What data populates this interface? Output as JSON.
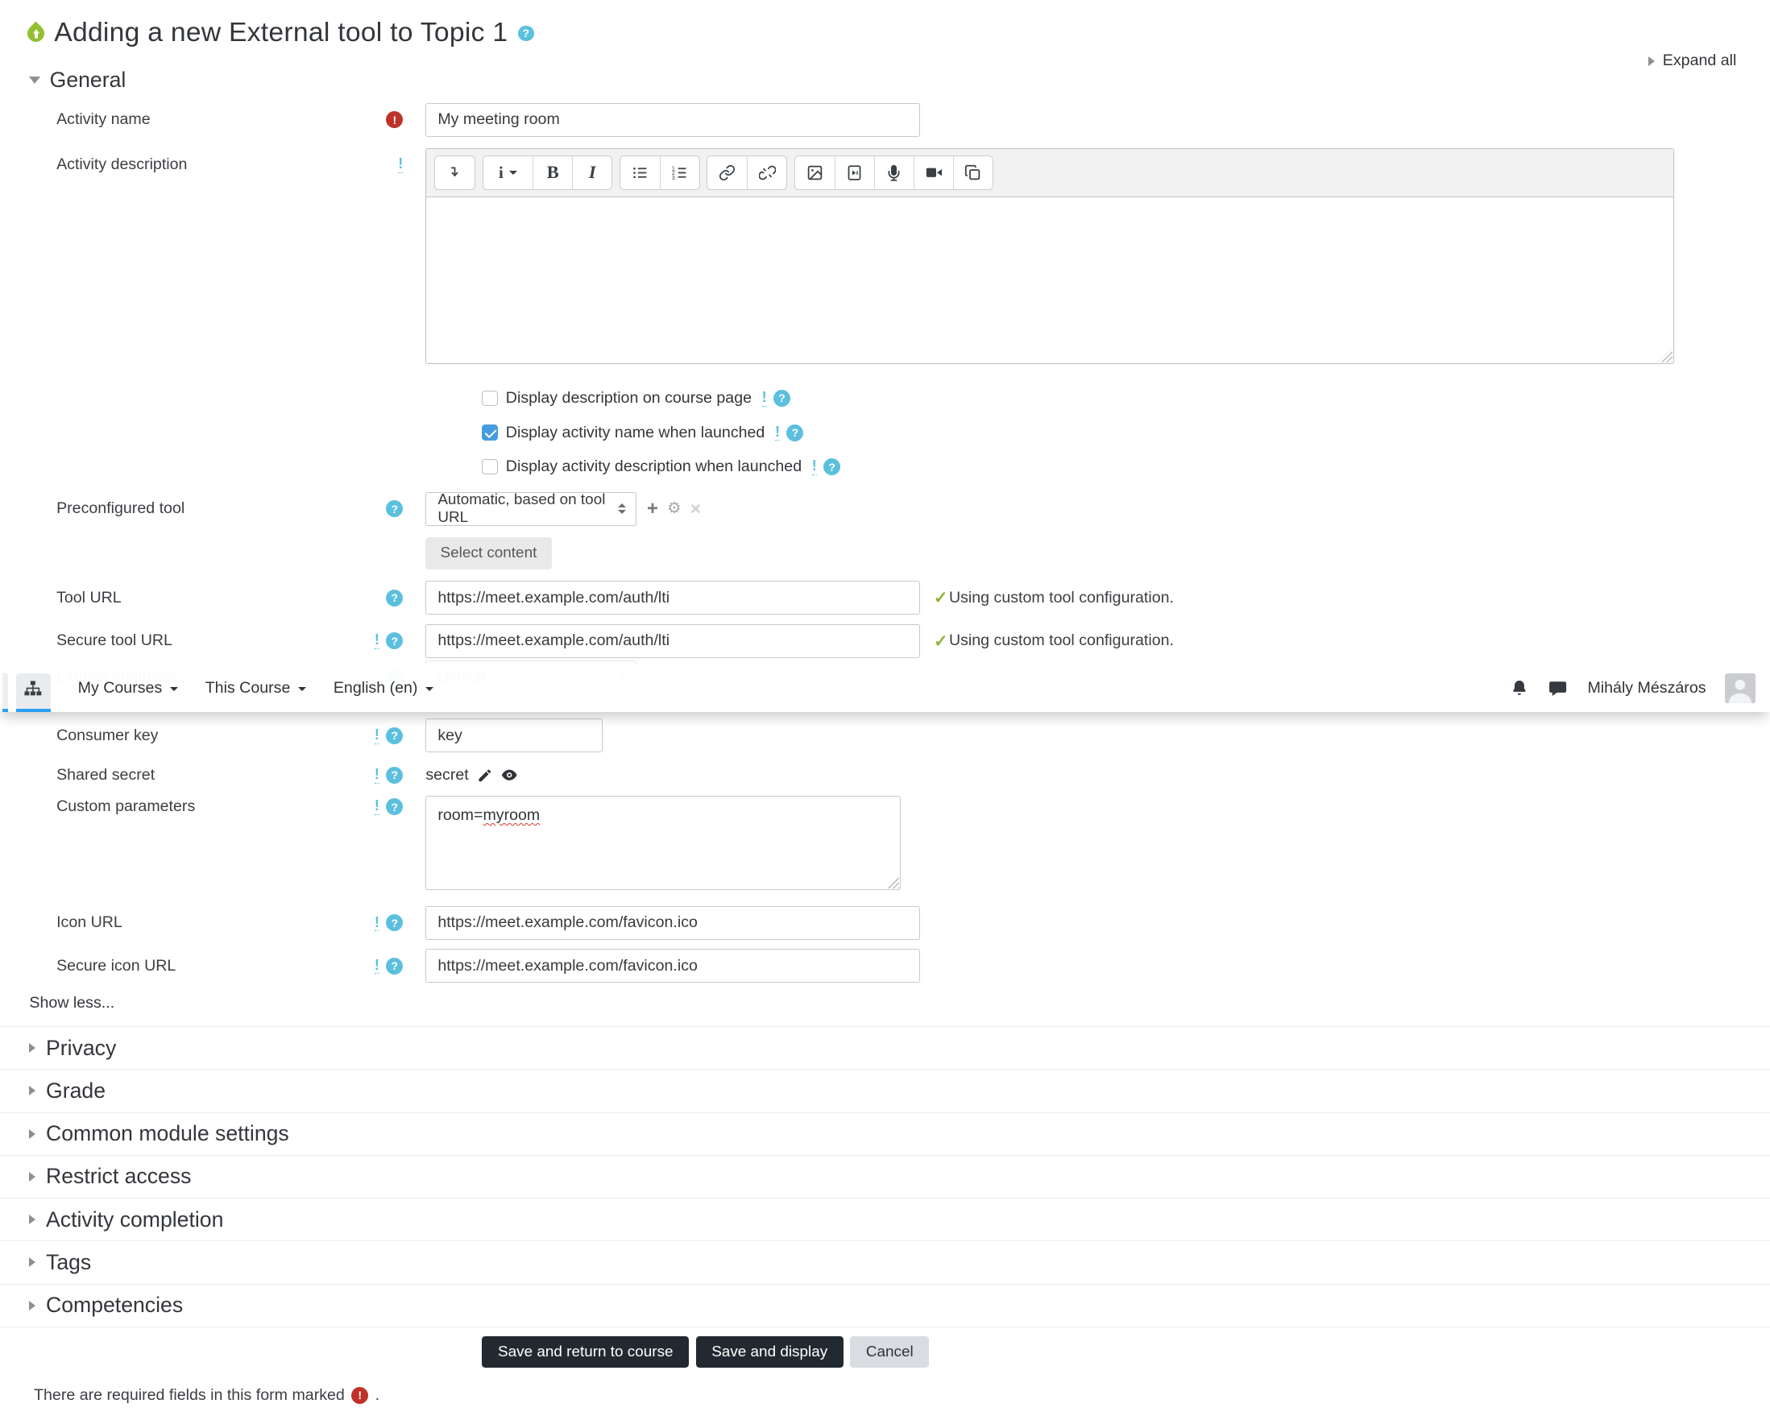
{
  "glyphs": {
    "help": "?",
    "advanced": "!",
    "required": "!",
    "check": "✓",
    "plus": "+",
    "gear": "⚙",
    "close": "×",
    "style_letter": "i",
    "bold_letter": "B",
    "italic_letter": "I"
  },
  "header": {
    "title": "Adding a new External tool to Topic 1",
    "expand_all": "Expand all"
  },
  "navbar": {
    "menus": [
      {
        "label": "My Courses"
      },
      {
        "label": "This Course"
      },
      {
        "label": "English (en)"
      }
    ],
    "user_name": "Mihály Mészáros"
  },
  "general": {
    "heading": "General",
    "activity_name": {
      "label": "Activity name",
      "value": "My meeting room"
    },
    "activity_description": {
      "label": "Activity description"
    },
    "checkboxes": [
      {
        "label": "Display description on course page",
        "checked": false
      },
      {
        "label": "Display activity name when launched",
        "checked": true
      },
      {
        "label": "Display activity description when launched",
        "checked": false
      }
    ],
    "preconfigured_tool": {
      "label": "Preconfigured tool",
      "value": "Automatic, based on tool URL",
      "select_content_label": "Select content"
    },
    "tool_url": {
      "label": "Tool URL",
      "value": "https://meet.example.com/auth/lti",
      "status": "Using custom tool configuration."
    },
    "secure_tool_url": {
      "label": "Secure tool URL",
      "value": "https://meet.example.com/auth/lti",
      "status": "Using custom tool configuration."
    },
    "launch_container": {
      "label": "Launch container",
      "value": "Default"
    },
    "consumer_key": {
      "label": "Consumer key",
      "value": "key"
    },
    "shared_secret": {
      "label": "Shared secret",
      "value": "secret"
    },
    "custom_parameters": {
      "label": "Custom parameters",
      "value": "room=myroom",
      "value_plain": "room=",
      "value_misspelled": "myroom"
    },
    "icon_url": {
      "label": "Icon URL",
      "value": "https://meet.example.com/favicon.ico"
    },
    "secure_icon_url": {
      "label": "Secure icon URL",
      "value": "https://meet.example.com/favicon.ico"
    },
    "show_less": "Show less..."
  },
  "sections": [
    {
      "label": "Privacy"
    },
    {
      "label": "Grade"
    },
    {
      "label": "Common module settings"
    },
    {
      "label": "Restrict access"
    },
    {
      "label": "Activity completion"
    },
    {
      "label": "Tags"
    },
    {
      "label": "Competencies"
    }
  ],
  "actions": {
    "save_return": "Save and return to course",
    "save_display": "Save and display",
    "cancel": "Cancel"
  },
  "footer": {
    "required_note": "There are required fields in this form marked",
    "required_note_suffix": "."
  },
  "colors": {
    "info_blue": "#5bc0de",
    "required_red": "#bf3229",
    "check_green": "#8db434",
    "checkbox_blue": "#459ce0",
    "nav_active_blue": "#2a9ff3",
    "button_dark": "#232931",
    "lti_green": "#93c02f"
  }
}
